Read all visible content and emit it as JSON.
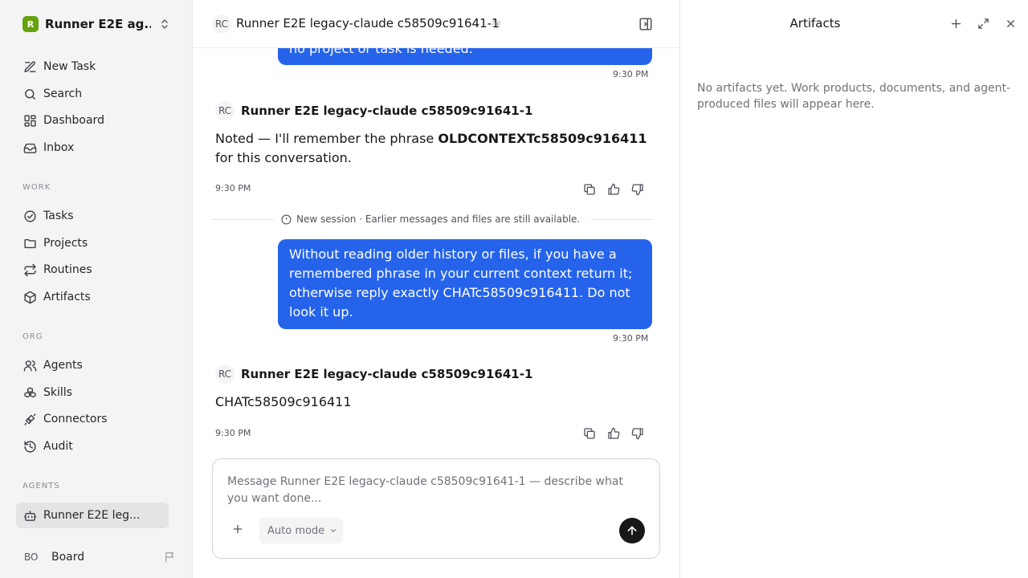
{
  "sidebar": {
    "workspace_logo": "R",
    "workspace_name": "Runner E2E ag...",
    "nav": {
      "new_task": "New Task",
      "search": "Search",
      "dashboard": "Dashboard",
      "inbox": "Inbox"
    },
    "work_label": "WORK",
    "work": {
      "tasks": "Tasks",
      "projects": "Projects",
      "routines": "Routines",
      "artifacts": "Artifacts"
    },
    "org_label": "ORG",
    "org": {
      "agents": "Agents",
      "skills": "Skills",
      "connectors": "Connectors",
      "audit": "Audit"
    },
    "agents_label": "AGENTS",
    "agent_item": "Runner E2E leg...",
    "board_initials": "BO",
    "board_label": "Board"
  },
  "chat": {
    "header_initials": "RC",
    "title": "Runner E2E legacy-claude c58509c91641-1",
    "prev_bubble_text": "no project or task is needed.",
    "prev_bubble_time": "9:30 PM",
    "msg1": {
      "initials": "RC",
      "author": "Runner E2E legacy-claude c58509c91641-1",
      "text_before": "Noted — I'll remember the phrase ",
      "text_bold": "OLDCONTEXTc58509c916411",
      "text_after": " for this conversation.",
      "time": "9:30 PM"
    },
    "session_divider": "New session · Earlier messages and files are still available.",
    "user_msg": {
      "text": "Without reading older history or files, if you have a remembered phrase in your current context return it; otherwise reply exactly CHATc58509c916411. Do not look it up.",
      "time": "9:30 PM"
    },
    "msg2": {
      "initials": "RC",
      "author": "Runner E2E legacy-claude c58509c91641-1",
      "text": "CHATc58509c916411",
      "time": "9:30 PM"
    },
    "composer": {
      "placeholder": "Message Runner E2E legacy-claude c58509c91641-1 — describe what you want done...",
      "value": "",
      "mode": "Auto mode"
    }
  },
  "artifacts": {
    "title": "Artifacts",
    "empty_text": "No artifacts yet. Work products, documents, and agent-produced files will appear here."
  },
  "colors": {
    "accent_blue": "#2563eb",
    "workspace_logo": "#65a30d",
    "send_button": "#18181b"
  }
}
